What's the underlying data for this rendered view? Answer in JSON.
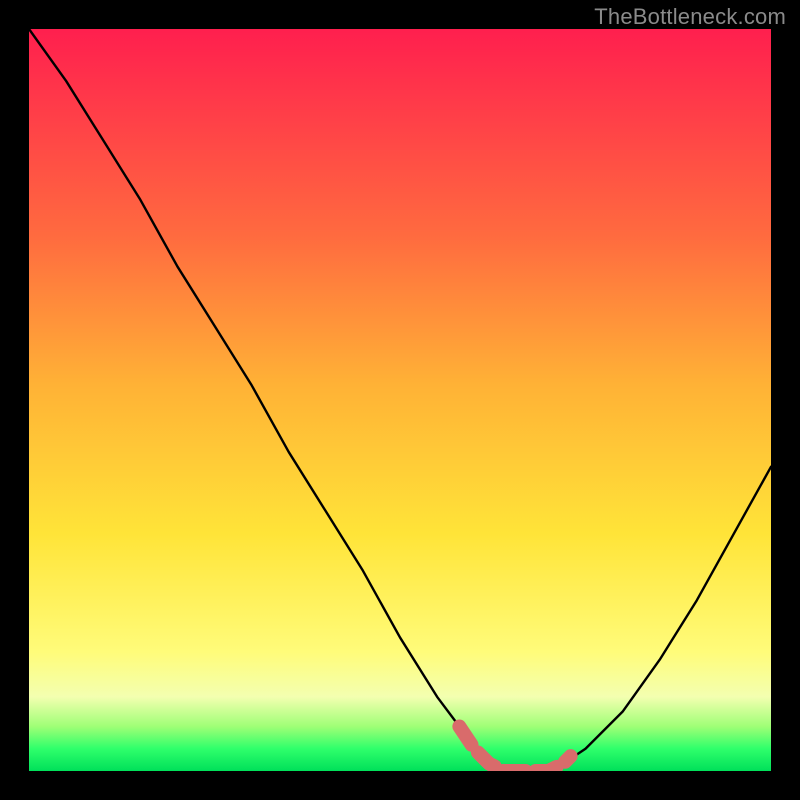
{
  "watermark": "TheBottleneck.com",
  "colors": {
    "curve_stroke": "#000000",
    "highlight_stroke": "#d96b6b",
    "gradient_top": "#ff1f4e",
    "gradient_bottom": "#00e05a"
  },
  "chart_data": {
    "type": "line",
    "title": "",
    "xlabel": "",
    "ylabel": "",
    "xlim": [
      0,
      100
    ],
    "ylim": [
      0,
      100
    ],
    "grid": false,
    "legend": false,
    "series": [
      {
        "name": "bottleneck-curve",
        "x": [
          0,
          5,
          10,
          15,
          20,
          25,
          30,
          35,
          40,
          45,
          50,
          55,
          58,
          60,
          62,
          64,
          66,
          68,
          70,
          72,
          75,
          80,
          85,
          90,
          95,
          100
        ],
        "y": [
          100,
          93,
          85,
          77,
          68,
          60,
          52,
          43,
          35,
          27,
          18,
          10,
          6,
          3,
          1,
          0,
          0,
          0,
          0,
          1,
          3,
          8,
          15,
          23,
          32,
          41
        ]
      },
      {
        "name": "optimal-range-highlight",
        "x": [
          58,
          60,
          62,
          64,
          66,
          68,
          70,
          72,
          73
        ],
        "y": [
          6,
          3,
          1,
          0,
          0,
          0,
          0,
          1,
          2
        ]
      }
    ],
    "annotations": []
  }
}
